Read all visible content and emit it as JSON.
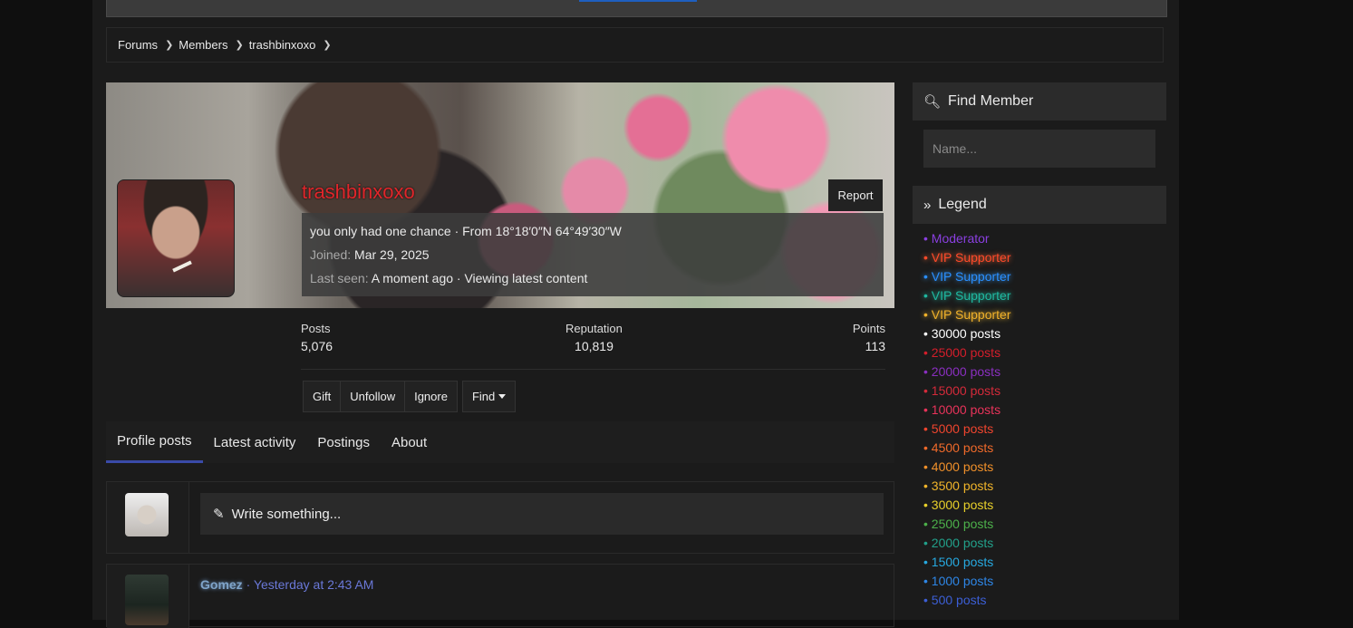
{
  "breadcrumb": {
    "items": [
      "Forums",
      "Members",
      "trashbinxoxo"
    ]
  },
  "profile": {
    "username": "trashbinxoxo",
    "report_label": "Report",
    "tagline": "you only had one chance · From 18°18′0″N 64°49′30″W",
    "joined_label": "Joined:",
    "joined_value": "Mar 29, 2025",
    "last_seen_label": "Last seen:",
    "last_seen_value": "A moment ago · Viewing latest content"
  },
  "stats": {
    "posts_label": "Posts",
    "posts_value": "5,076",
    "rep_label": "Reputation",
    "rep_value": "10,819",
    "points_label": "Points",
    "points_value": "113"
  },
  "actions": {
    "gift": "Gift",
    "unfollow": "Unfollow",
    "ignore": "Ignore",
    "find": "Find"
  },
  "tabs": [
    "Profile posts",
    "Latest activity",
    "Postings",
    "About"
  ],
  "write": {
    "placeholder": "Write something..."
  },
  "post": {
    "user": "Gomez",
    "separator": " · ",
    "time": "Yesterday at 2:43 AM"
  },
  "sidebar": {
    "find_member_title": "Find Member",
    "name_placeholder": "Name...",
    "legend_title": "Legend",
    "legend": [
      {
        "label": "• Moderator",
        "color": "#8a3fe0",
        "glow": ""
      },
      {
        "label": "• VIP Supporter",
        "color": "#ff4a2a",
        "glow": "#ff6a3a"
      },
      {
        "label": "• VIP Supporter",
        "color": "#2a8fff",
        "glow": "#3aa0ff"
      },
      {
        "label": "• VIP Supporter",
        "color": "#1fb8a0",
        "glow": "#26cdb2"
      },
      {
        "label": "• VIP Supporter",
        "color": "#f0b12a",
        "glow": "#ffc23a"
      },
      {
        "label": "• 30000 posts",
        "color": "#ffffff",
        "glow": ""
      },
      {
        "label": "• 25000 posts",
        "color": "#d41e2b",
        "glow": ""
      },
      {
        "label": "• 20000 posts",
        "color": "#8a2fc0",
        "glow": ""
      },
      {
        "label": "• 15000 posts",
        "color": "#d42a3a",
        "glow": ""
      },
      {
        "label": "• 10000 posts",
        "color": "#e8335a",
        "glow": ""
      },
      {
        "label": "• 5000 posts",
        "color": "#f0452e",
        "glow": ""
      },
      {
        "label": "• 4500 posts",
        "color": "#f06a2a",
        "glow": ""
      },
      {
        "label": "• 4000 posts",
        "color": "#f0902a",
        "glow": ""
      },
      {
        "label": "• 3500 posts",
        "color": "#f0b42a",
        "glow": ""
      },
      {
        "label": "• 3000 posts",
        "color": "#e8d02a",
        "glow": ""
      },
      {
        "label": "• 2500 posts",
        "color": "#4cb04a",
        "glow": ""
      },
      {
        "label": "• 2000 posts",
        "color": "#22a08a",
        "glow": ""
      },
      {
        "label": "• 1500 posts",
        "color": "#27a9e0",
        "glow": ""
      },
      {
        "label": "• 1000 posts",
        "color": "#2e86e6",
        "glow": ""
      },
      {
        "label": "• 500 posts",
        "color": "#3c5fd6",
        "glow": ""
      }
    ]
  }
}
